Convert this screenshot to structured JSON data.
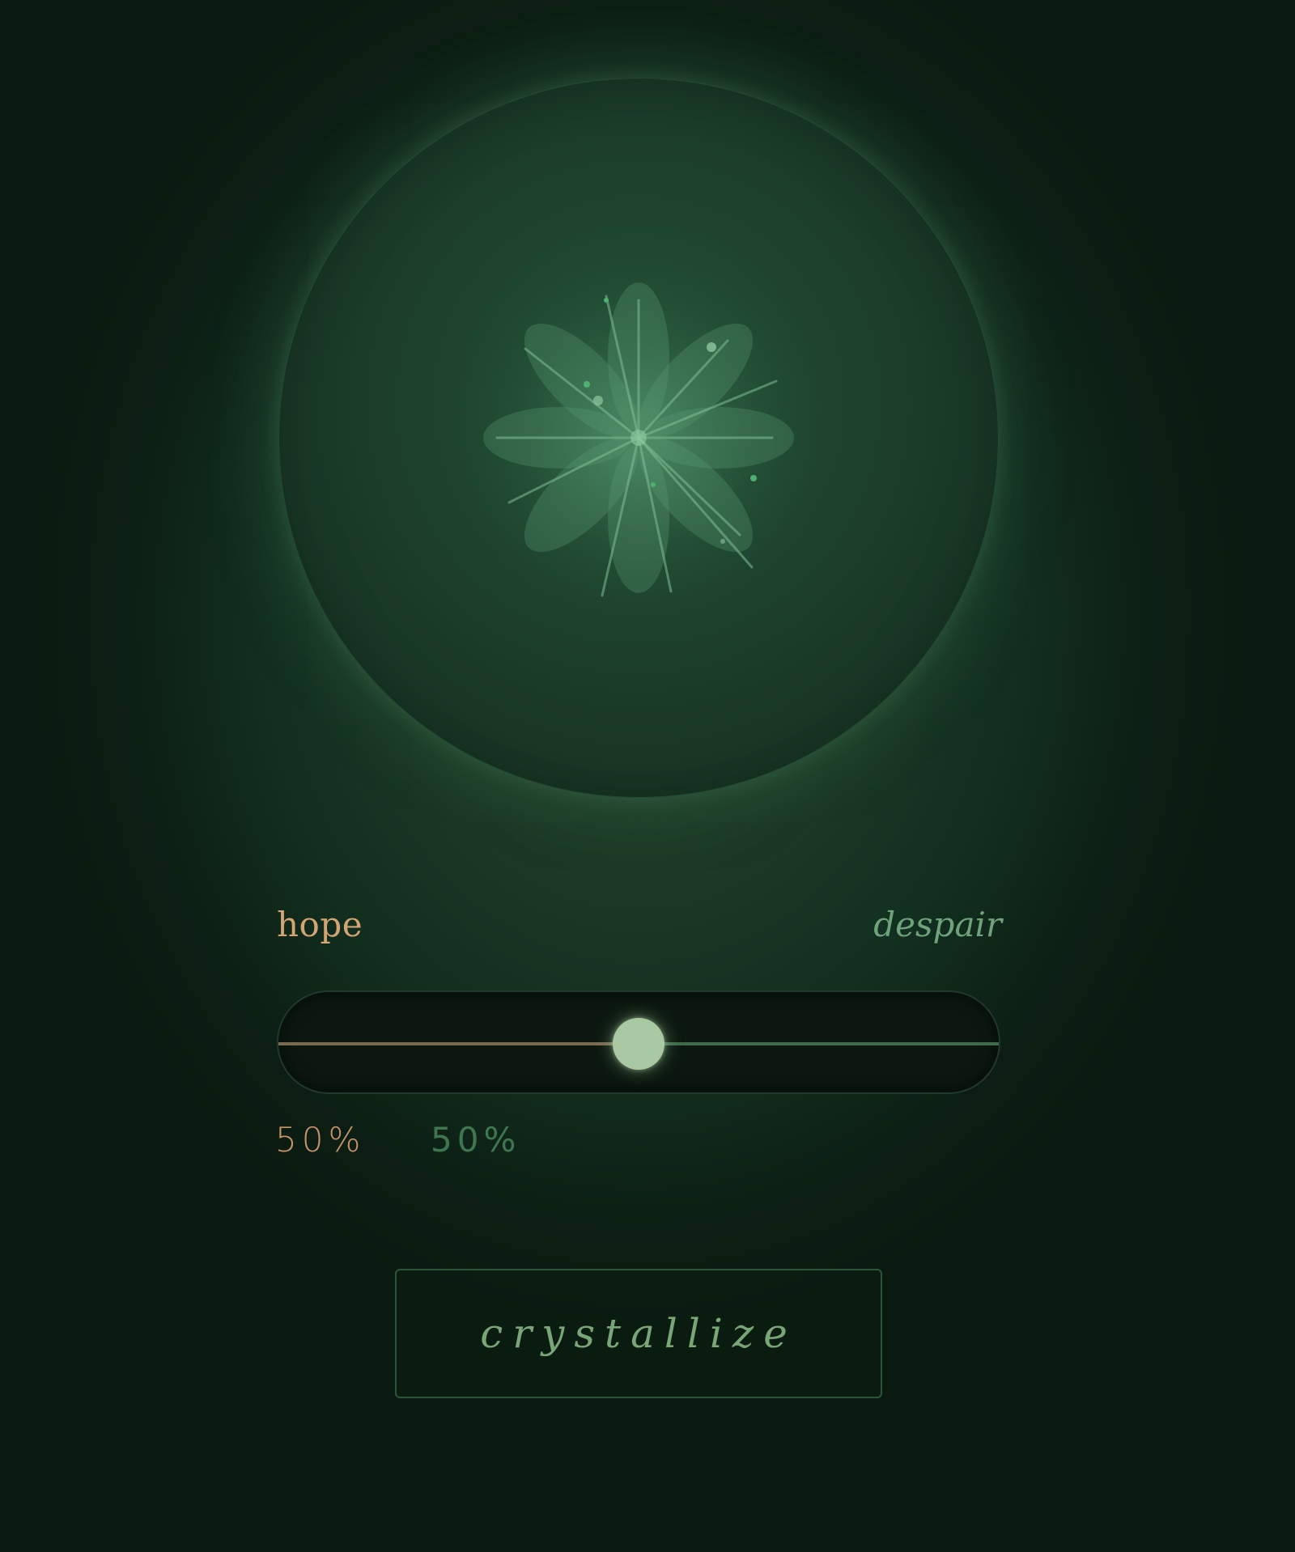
{
  "slider": {
    "left_label": "hope",
    "right_label": "despair",
    "value": 0.5,
    "left_percent": "50%",
    "right_percent": "50%"
  },
  "action": {
    "button_label": "crystallize"
  },
  "colors": {
    "hope": "#d4a574",
    "despair": "#6fa27b",
    "thumb": "#a9c9a2"
  },
  "orb": {
    "icon": "flower-starburst-icon"
  }
}
